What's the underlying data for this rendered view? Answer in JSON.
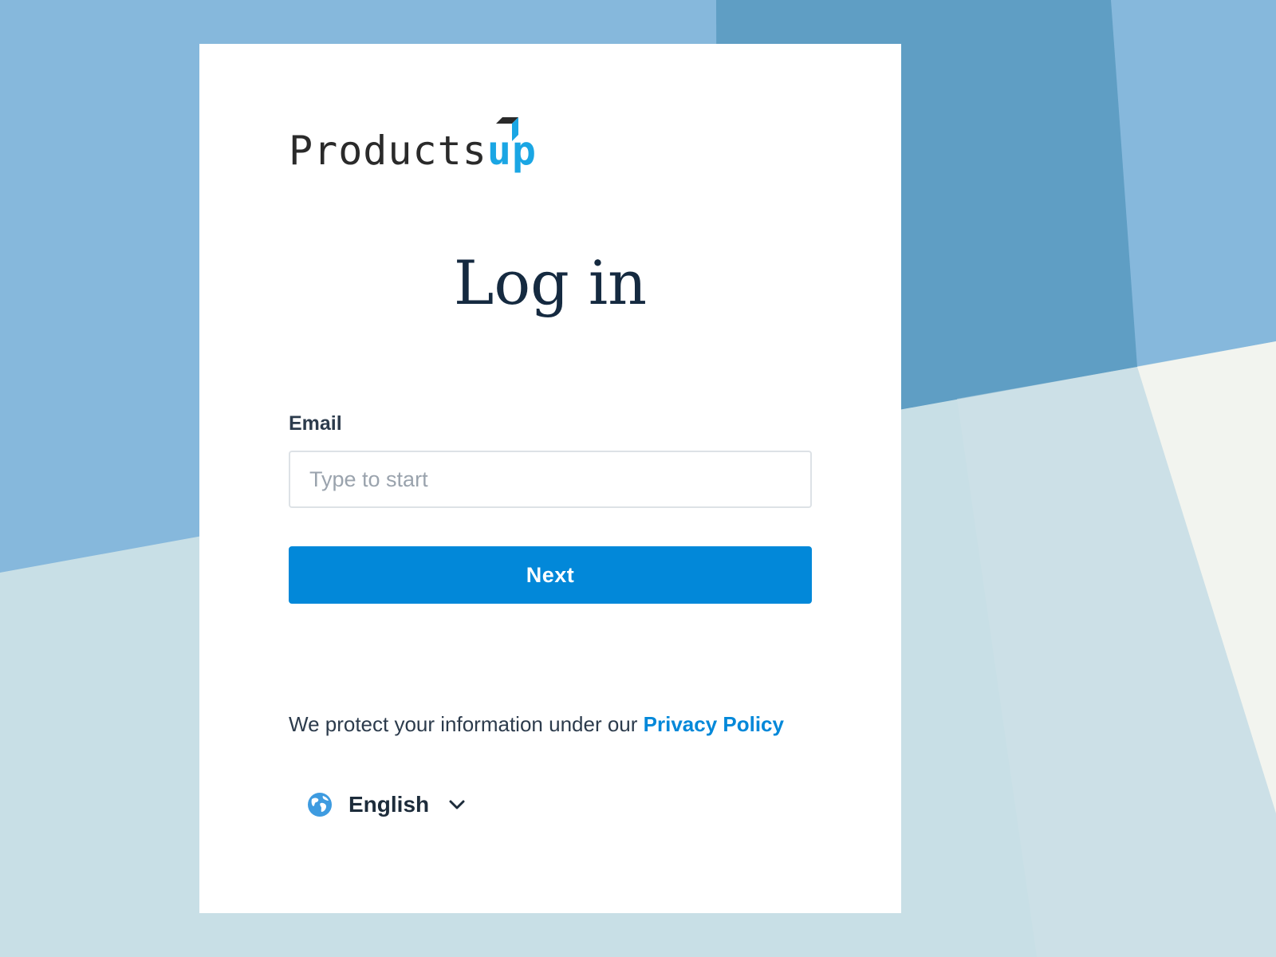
{
  "colors": {
    "accent": "#0288d9",
    "logo_up": "#1aa6e4",
    "title": "#152a40",
    "bg_dark": "#5f9ec4",
    "bg_mid": "#86b8dc",
    "bg_light": "#c8dfe6",
    "bg_cream": "#f2f4ef"
  },
  "logo": {
    "part_products": "Products",
    "part_up": "up"
  },
  "login": {
    "title": "Log in",
    "email_label": "Email",
    "email_value": "",
    "email_placeholder": "Type to start",
    "next_label": "Next"
  },
  "footer": {
    "privacy_text": "We protect your information under our ",
    "privacy_link": "Privacy Policy"
  },
  "language": {
    "icon": "globe-icon",
    "selected": "English",
    "chevron": "chevron-down-icon"
  }
}
